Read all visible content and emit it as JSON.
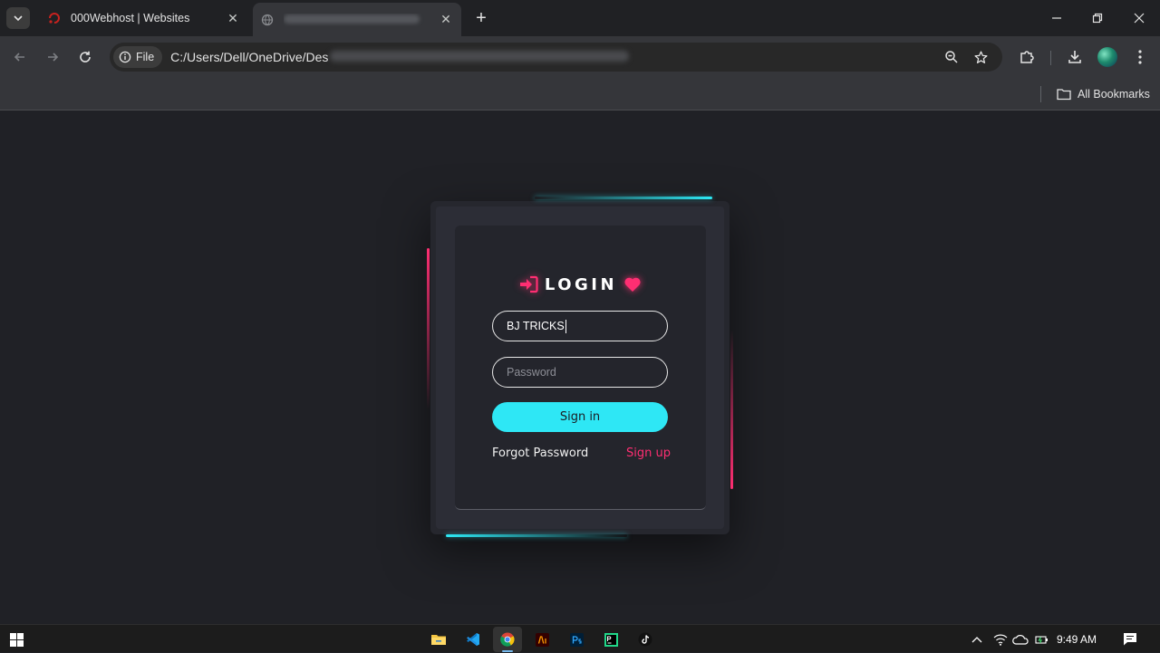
{
  "browser": {
    "tabs": [
      {
        "title": "000Webhost | Websites",
        "active": false
      },
      {
        "title": "",
        "active": true
      }
    ],
    "address": {
      "chip_label": "File",
      "url": "C:/Users/Dell/OneDrive/Des"
    },
    "bookmarks": {
      "all_label": "All Bookmarks"
    }
  },
  "login": {
    "title": "LOGIN",
    "username_value": "BJ TRICKS",
    "password_placeholder": "Password",
    "signin_label": "Sign in",
    "forgot_label": "Forgot Password",
    "signup_label": "Sign up"
  },
  "colors": {
    "accent_cyan": "#2ee7f5",
    "accent_pink": "#ff2e72",
    "background": "#202126"
  },
  "taskbar": {
    "apps": [
      "file-explorer-icon",
      "vscode-icon",
      "chrome-icon",
      "illustrator-icon",
      "photoshop-icon",
      "pycharm-icon",
      "tiktok-icon"
    ],
    "time": "9:49 AM"
  }
}
